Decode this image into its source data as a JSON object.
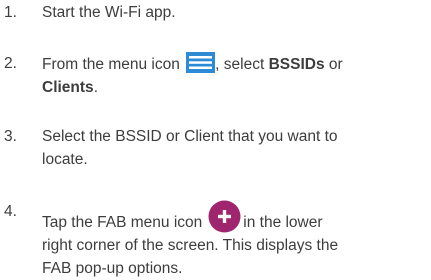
{
  "steps": [
    {
      "number": "1.",
      "text": "Start the Wi-Fi app."
    },
    {
      "number": "2.",
      "before_icon": "From the menu icon ",
      "icon": "menu-icon",
      "after_icon": ", select ",
      "bold1": "BSSIDs",
      "middle": " or",
      "bold2": "Clients",
      "end": "."
    },
    {
      "number": "3.",
      "line1": "Select the BSSID or Client that you want to",
      "line2": "locate."
    },
    {
      "number": "4.",
      "before_icon": "Tap the FAB menu icon",
      "icon": "fab-plus-icon",
      "after_icon": "in the lower",
      "line2": "right corner of the screen. This displays the",
      "line3": "FAB pop-up options."
    }
  ],
  "colors": {
    "text": "#3d3d3d",
    "menu_icon": "#2d8bd6",
    "fab_icon": "#a0256f"
  }
}
